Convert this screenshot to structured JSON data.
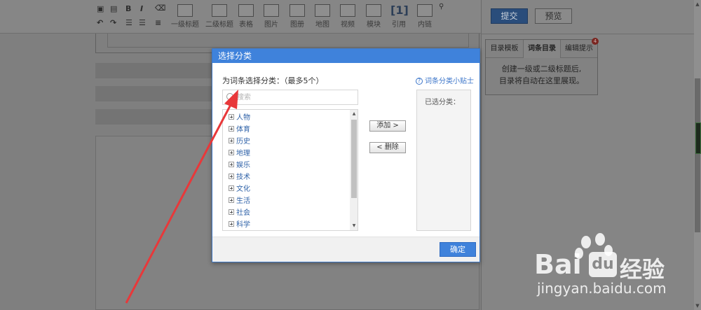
{
  "toolbar": {
    "items": [
      {
        "label": "一级标题",
        "icon": "heading1-icon"
      },
      {
        "label": "二级标题",
        "icon": "heading2-icon"
      },
      {
        "label": "表格",
        "icon": "table-icon"
      },
      {
        "label": "图片",
        "icon": "image-icon"
      },
      {
        "label": "图册",
        "icon": "album-icon"
      },
      {
        "label": "地图",
        "icon": "map-icon"
      },
      {
        "label": "视频",
        "icon": "video-icon"
      },
      {
        "label": "模块",
        "icon": "module-icon"
      },
      {
        "label": "引用",
        "icon": "quote-icon"
      },
      {
        "label": "内链",
        "icon": "internal-link-icon"
      }
    ],
    "quote_glyph": "[1]",
    "bold": "B",
    "italic": "I"
  },
  "right_panel": {
    "submit_label": "提交",
    "preview_label": "预览",
    "tabs": [
      "目录模板",
      "词条目录",
      "编辑提示"
    ],
    "badge_count": "4",
    "toc_hint_line1": "创建一级或二级标题后,",
    "toc_hint_line2": "目录将自动在这里展现。"
  },
  "modal": {
    "title": "选择分类",
    "prompt": "为词条选择分类：（最多5个）",
    "tips_link": "词条分类小贴士",
    "search_placeholder": "搜索",
    "categories": [
      "人物",
      "体育",
      "历史",
      "地理",
      "娱乐",
      "技术",
      "文化",
      "生活",
      "社会",
      "科学"
    ],
    "add_label": "添加 >",
    "remove_label": "< 删除",
    "selected_label": "已选分类：",
    "confirm_label": "确定"
  },
  "watermark": {
    "brand": "Bai",
    "brand_suffix": "经验",
    "url": "jingyan.baidu.com"
  },
  "colors": {
    "modal_header": "#3f82db",
    "link": "#2f62a8",
    "annotation_arrow": "#e8383a"
  }
}
